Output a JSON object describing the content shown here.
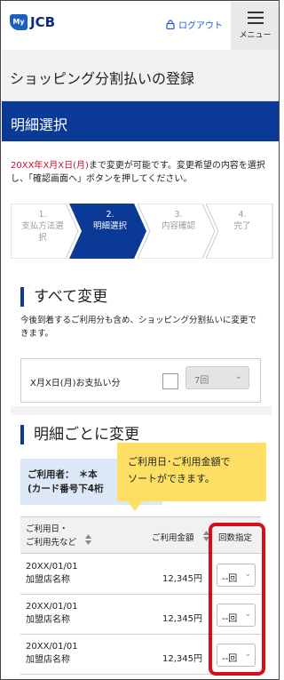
{
  "header": {
    "logo_my": "My",
    "logo_jcb": "JCB",
    "logout_label": "ログアウト",
    "menu_label": "メニュー"
  },
  "page_title": "ショッピング分割払いの登録",
  "section_band_title": "明細選択",
  "notice": {
    "deadline": "20XX年X月X日(月)",
    "text": "まで変更が可能です。変更希望の内容を選択し、「確認画面へ」ボタンを押してください。"
  },
  "steps": [
    {
      "num": "1.",
      "label": "支払方法選",
      "label2": "択"
    },
    {
      "num": "2.",
      "label": "明細選択",
      "label2": ""
    },
    {
      "num": "3.",
      "label": "内容確認",
      "label2": ""
    },
    {
      "num": "4.",
      "label": "完了",
      "label2": ""
    }
  ],
  "all_change": {
    "title": "すべて変更",
    "description": "今後到着するご利用分も含め、ショッピング分割払いに変更できます。",
    "payment_label": "X月X日(月)お支払い分",
    "select_value": "7回"
  },
  "per_item": {
    "title": "明細ごとに変更",
    "user_label_line1": "ご利用者：　＊本",
    "user_label_line2": "(カード番号下4桁"
  },
  "tooltip": {
    "line1": "ご利用日･ご利用金額で",
    "line2": "ソートができます。"
  },
  "table": {
    "col_date_line1": "ご利用日・",
    "col_date_line2": "ご利用先など",
    "col_amount": "ご利用金額",
    "col_count": "回数指定",
    "rows": [
      {
        "date": "20XX/01/01",
        "merchant": "加盟店名称",
        "amount": "12,345円",
        "count": "--回"
      },
      {
        "date": "20XX/01/01",
        "merchant": "加盟店名称",
        "amount": "12,345円",
        "count": "--回"
      },
      {
        "date": "20XX/01/01",
        "merchant": "加盟店名称",
        "amount": "12,345円",
        "count": "--回"
      }
    ]
  },
  "colors": {
    "brand_blue": "#0a3a96",
    "accent_red": "#c8102e",
    "highlight": "#d40f1c",
    "tooltip_bg": "#fde063"
  }
}
